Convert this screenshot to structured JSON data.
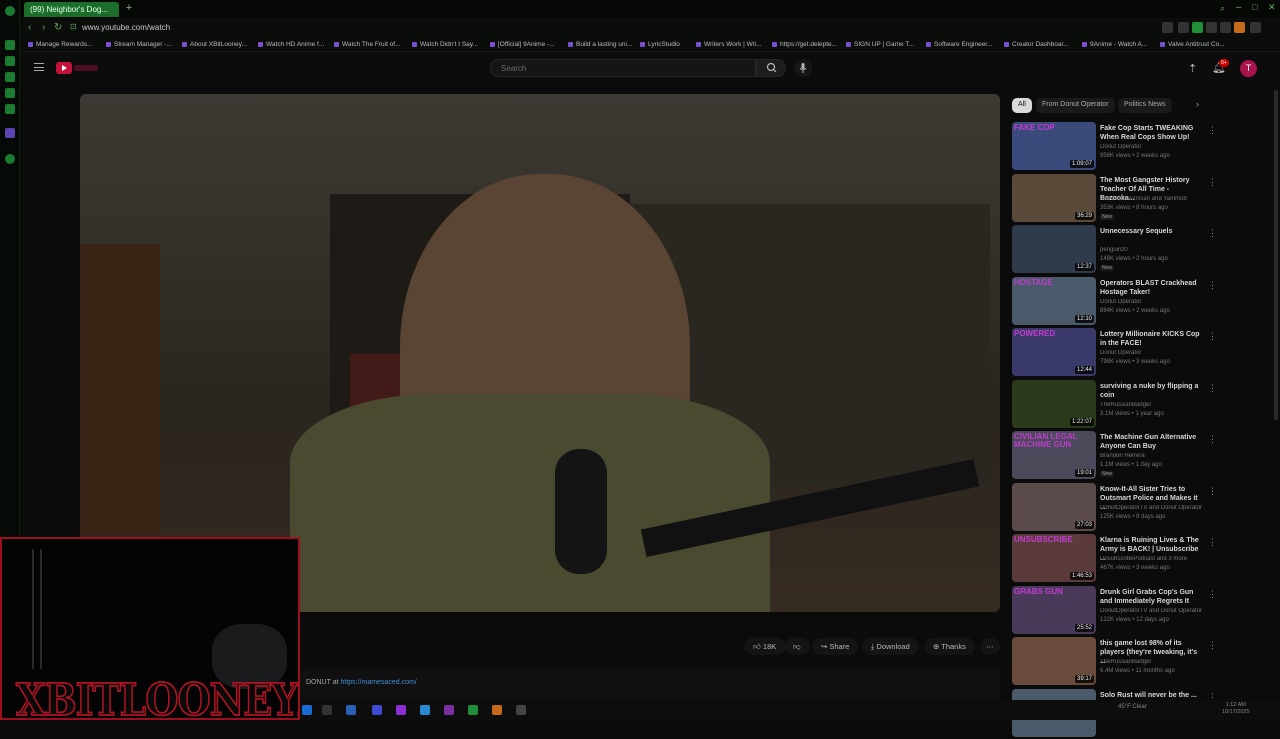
{
  "browser": {
    "active_tab": "(99) Neighbor's Dog...",
    "url": "www.youtube.com/watch",
    "bookmarks": [
      "Manage Rewards...",
      "Stream Manager -...",
      "About XBitLooney...",
      "Watch HD Anime f...",
      "Watch The Fruit of...",
      "Watch Didn't I Say...",
      "[Official] 9Anime -...",
      "Build a lasting uni...",
      "LyricStudio",
      "Writers Work | Wri...",
      "https://get.delepte...",
      "SIGN UP | Game T...",
      "Software Engineer...",
      "Creator Dashboar...",
      "9Anime - Watch A...",
      "Valve Antitrust Co..."
    ]
  },
  "header": {
    "search_placeholder": "Search",
    "notification_count": "9+",
    "avatar_letter": "T"
  },
  "actions": {
    "likes": "18K",
    "share": "Share",
    "download": "Download",
    "thanks": "Thanks"
  },
  "description": {
    "text": "DONUT at ",
    "link": "https://mamesaced.com/"
  },
  "overlay": {
    "logo_text": "XBITLOONEYX"
  },
  "chips": [
    "All",
    "From Donut Operator",
    "Politics News"
  ],
  "recommendations": [
    {
      "title": "Fake Cop Starts TWEAKING When Real Cops Show Up!",
      "channel": "Donut Operator",
      "meta": "958K views • 2 weeks ago",
      "duration": "1:09:07",
      "overlay": "FAKE COP",
      "color": "#3a4a7a",
      "new": ""
    },
    {
      "title": "The Most Gangster History Teacher Of All Time - Bazooka...",
      "channel": "The Fat Electrician and Yammob",
      "meta": "353K views • 8 hours ago",
      "duration": "36:29",
      "overlay": "",
      "color": "#5a4a3a",
      "new": "New"
    },
    {
      "title": "Unnecessary Sequels",
      "channel": "penguinz0",
      "meta": "148K views • 2 hours ago",
      "duration": "12:37",
      "overlay": "",
      "color": "#2f3b4a",
      "new": "New"
    },
    {
      "title": "Operators BLAST Crackhead Hostage Taker!",
      "channel": "Donut Operator",
      "meta": "884K views • 2 weeks ago",
      "duration": "12:10",
      "overlay": "HOSTAGE",
      "color": "#4a5a6a",
      "new": ""
    },
    {
      "title": "Lottery Millionaire KICKS Cop in the FACE!",
      "channel": "Donut Operator",
      "meta": "798K views • 3 weeks ago",
      "duration": "12:44",
      "overlay": "POWERED",
      "color": "#3a3a6a",
      "new": ""
    },
    {
      "title": "surviving a nuke by flipping a coin",
      "channel": "TheRussianBadger",
      "meta": "3.1M views • 1 year ago",
      "duration": "1:22:07",
      "overlay": "",
      "color": "#2a3a1a",
      "new": ""
    },
    {
      "title": "The Machine Gun Alternative Anyone Can Buy",
      "channel": "Brandon Herrera",
      "meta": "1.1M views • 1 day ago",
      "duration": "19:01",
      "overlay": "CIVILIAN LEGAL MACHINE GUN",
      "color": "#4a4a5a",
      "new": "New"
    },
    {
      "title": "Know-It-All Sister Tries to Outsmart Police and Makes it ...",
      "channel": "DonutOperatorTV and Donut Operator",
      "meta": "125K views • 8 days ago",
      "duration": "27:03",
      "overlay": "",
      "color": "#5a4a4a",
      "new": ""
    },
    {
      "title": "Klarna is Ruining Lives & The Army is BACK! | Unsubscribe ...",
      "channel": "UnsubscribePodcast and 3 more",
      "meta": "467K views • 3 weeks ago",
      "duration": "1:46:53",
      "overlay": "UNSUBSCRIBE",
      "color": "#5a3a3a",
      "new": ""
    },
    {
      "title": "Drunk Girl Grabs Cop's Gun and Immediately Regrets It",
      "channel": "DonutOperatorTV and Donut Operator",
      "meta": "122K views • 12 days ago",
      "duration": "25:52",
      "overlay": "GRABS GUN",
      "color": "#4a3a5a",
      "new": ""
    },
    {
      "title": "this game lost 98% of its players (they're tweaking, it's ...",
      "channel": "TheRussianBadger",
      "meta": "6.4M views • 11 months ago",
      "duration": "39:17",
      "overlay": "",
      "color": "#6a4a3a",
      "new": ""
    },
    {
      "title": "Solo Rust will never be the ...",
      "channel": "",
      "meta": "",
      "duration": "",
      "overlay": "",
      "color": "#4a5a6a",
      "new": ""
    }
  ],
  "taskbar": {
    "weather": "45°F Clear",
    "time": "1:12 AM",
    "date": "10/17/2025"
  }
}
